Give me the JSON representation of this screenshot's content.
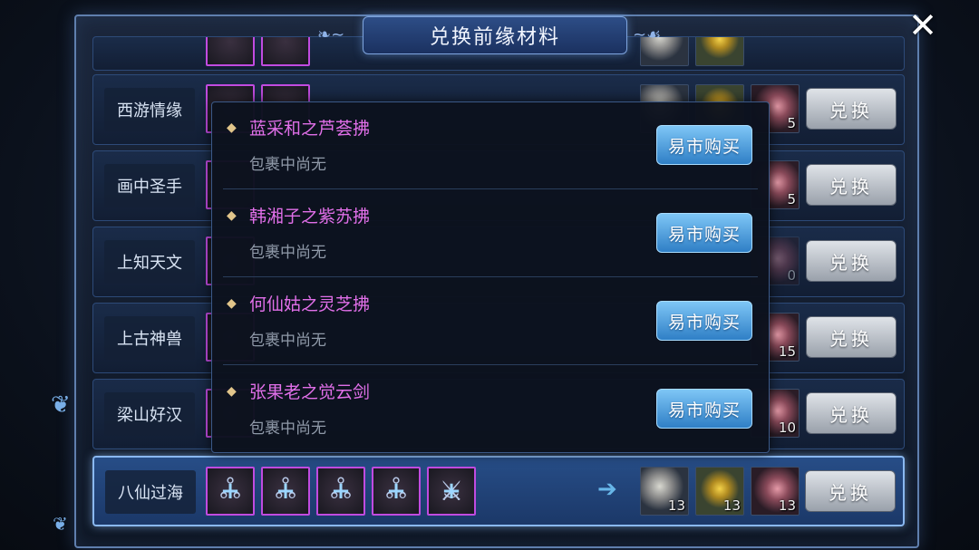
{
  "dialog": {
    "title": "兑换前缘材料",
    "close_icon": "close-icon"
  },
  "rows": [
    {
      "label": "西游情缘",
      "exchange": "兑换",
      "counts": [
        "",
        "",
        "5"
      ]
    },
    {
      "label": "画中圣手",
      "exchange": "兑换",
      "counts": [
        "",
        "",
        "5"
      ]
    },
    {
      "label": "上知天文",
      "exchange": "兑换",
      "counts": [
        "",
        "",
        "0"
      ]
    },
    {
      "label": "上古神兽",
      "exchange": "兑换",
      "counts": [
        "",
        "",
        "15"
      ]
    },
    {
      "label": "梁山好汉",
      "exchange": "兑换",
      "counts": [
        "",
        "",
        "10"
      ]
    },
    {
      "label": "八仙过海",
      "exchange": "兑换",
      "counts": [
        "13",
        "13",
        "13"
      ]
    }
  ],
  "popup": {
    "items": [
      {
        "name": "蓝采和之芦荟拂",
        "status": "包裹中尚无",
        "buy": "易市购买"
      },
      {
        "name": "韩湘子之紫苏拂",
        "status": "包裹中尚无",
        "buy": "易市购买"
      },
      {
        "name": "何仙姑之灵芝拂",
        "status": "包裹中尚无",
        "buy": "易市购买"
      },
      {
        "name": "张果老之觉云剑",
        "status": "包裹中尚无",
        "buy": "易市购买"
      }
    ]
  },
  "colors": {
    "accent": "#8ab8f0",
    "item_name": "#e06fe8",
    "slot_border": "#c14be0"
  }
}
